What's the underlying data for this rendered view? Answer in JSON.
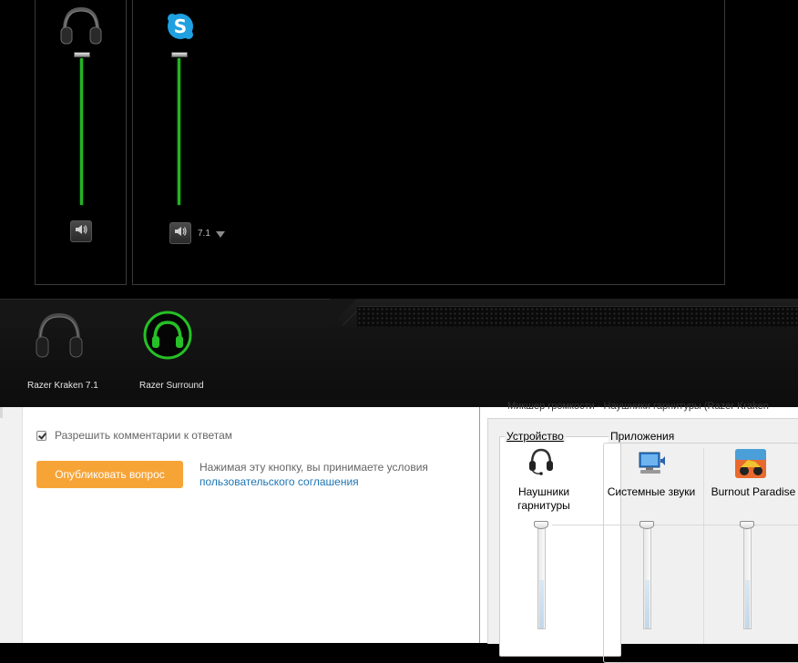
{
  "razer": {
    "mixer": {
      "master": {
        "icon": "headphones-icon",
        "level": 1.0
      },
      "skype": {
        "icon": "skype-icon",
        "level": 1.0,
        "mode_label": "7.1"
      }
    },
    "devices": [
      {
        "label": "Razer Kraken 7.1",
        "icon": "headphones-icon",
        "active": false
      },
      {
        "label": "Razer Surround",
        "icon": "razer-surround-icon",
        "active": true
      }
    ],
    "accent": "#26b226"
  },
  "web": {
    "allow_comments_label": "Разрешить комментарии к ответам",
    "allow_comments_checked": true,
    "publish_button": "Опубликовать вопрос",
    "terms_text": "Нажимая эту кнопку, вы принимаете условия",
    "terms_link": "пользовательского соглашения",
    "accent": "#f7a437"
  },
  "volume_mixer": {
    "title": "Микшер громкости - Наушники гарнитуры (Razer Kraken",
    "device_group_label": "Устройство",
    "apps_group_label": "Приложения",
    "channels": [
      {
        "line1": "Наушники",
        "line2": "гарнитуры",
        "icon": "headset-icon",
        "level": 1.0
      },
      {
        "line1": "Системные звуки",
        "line2": "",
        "icon": "system-sounds-icon",
        "level": 1.0
      },
      {
        "line1": "Burnout Paradise",
        "line2": "",
        "icon": "burnout-paradise-icon",
        "level": 1.0
      }
    ]
  }
}
